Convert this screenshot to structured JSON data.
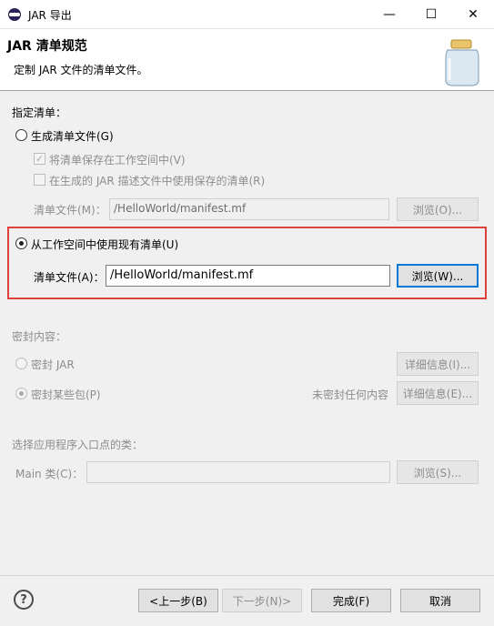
{
  "window": {
    "title": "JAR 导出",
    "minimize_glyph": "—",
    "maximize_glyph": "☐",
    "close_glyph": "✕"
  },
  "header": {
    "title": "JAR 清单规范",
    "subtitle": "定制 JAR 文件的清单文件。"
  },
  "manifest_section": {
    "heading": "指定清单：",
    "generate_option": "生成清单文件(G)",
    "save_in_workspace": "将清单保存在工作空间中(V)",
    "use_saved_in_desc": "在生成的 JAR 描述文件中使用保存的清单(R)",
    "manifest_file_label_disabled": "清单文件(M)：",
    "manifest_file_value_disabled": "/HelloWorld/manifest.mf",
    "browse_disabled_label": "浏览(O)...",
    "use_existing_option": "从工作空间中使用现有清单(U)",
    "manifest_file_label": "清单文件(A)：",
    "manifest_file_value": "/HelloWorld/manifest.mf",
    "browse_label": "浏览(W)..."
  },
  "seal_section": {
    "heading": "密封内容：",
    "seal_jar": "密封 JAR",
    "seal_packages": "密封某些包(P)",
    "details_label_1": "详细信息(I)...",
    "unsealed_text": "未密封任何内容",
    "details_label_2": "详细信息(E)..."
  },
  "entry_section": {
    "heading": "选择应用程序入口点的类：",
    "main_class_label": "Main 类(C)：",
    "main_class_value": "",
    "browse_label": "浏览(S)..."
  },
  "footer": {
    "help_glyph": "?",
    "back_label": "<上一步(B)",
    "next_label": "下一步(N)>",
    "finish_label": "完成(F)",
    "cancel_label": "取消"
  },
  "colors": {
    "highlight_border": "#e0403a",
    "focus_border": "#0078d7"
  }
}
